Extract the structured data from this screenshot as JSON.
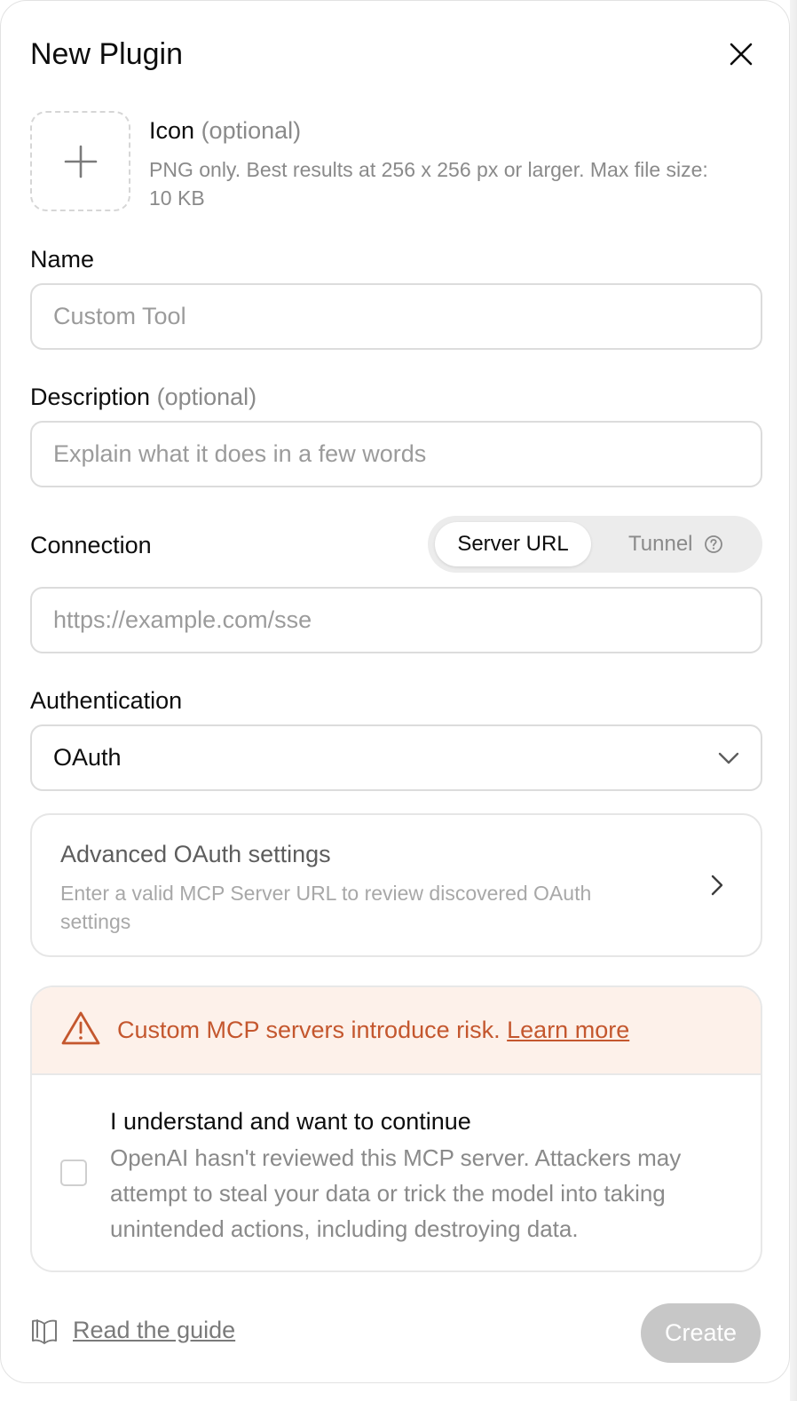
{
  "dialog": {
    "title": "New Plugin"
  },
  "icon_field": {
    "label": "Icon",
    "optional": "(optional)",
    "hint": "PNG only. Best results at 256 x 256 px or larger. Max file size: 10 KB"
  },
  "name_field": {
    "label": "Name",
    "placeholder": "Custom Tool",
    "value": ""
  },
  "description_field": {
    "label": "Description",
    "optional": "(optional)",
    "placeholder": "Explain what it does in a few words",
    "value": ""
  },
  "connection": {
    "label": "Connection",
    "options": [
      "Server URL",
      "Tunnel"
    ],
    "selected": "Server URL",
    "url_placeholder": "https://example.com/sse",
    "url_value": ""
  },
  "authentication": {
    "label": "Authentication",
    "selected": "OAuth"
  },
  "advanced_oauth": {
    "title": "Advanced OAuth settings",
    "description": "Enter a valid MCP Server URL to review discovered OAuth settings"
  },
  "risk": {
    "warning": "Custom MCP servers introduce risk.",
    "link": "Learn more",
    "ack_title": "I understand and want to continue",
    "ack_description": "OpenAI hasn't reviewed this MCP server. Attackers may attempt to steal your data or trick the model into taking unintended actions, including destroying data.",
    "checked": false
  },
  "footer": {
    "guide_link": "Read the guide",
    "create_button": "Create"
  },
  "colors": {
    "warning_text": "#c4572e",
    "warning_background": "#fdf1ea",
    "disabled_button": "#c7c7c7"
  },
  "icons": [
    "close-icon",
    "plus-icon",
    "help-circle-icon",
    "chevron-down-icon",
    "chevron-right-icon",
    "warning-triangle-icon",
    "book-icon"
  ]
}
